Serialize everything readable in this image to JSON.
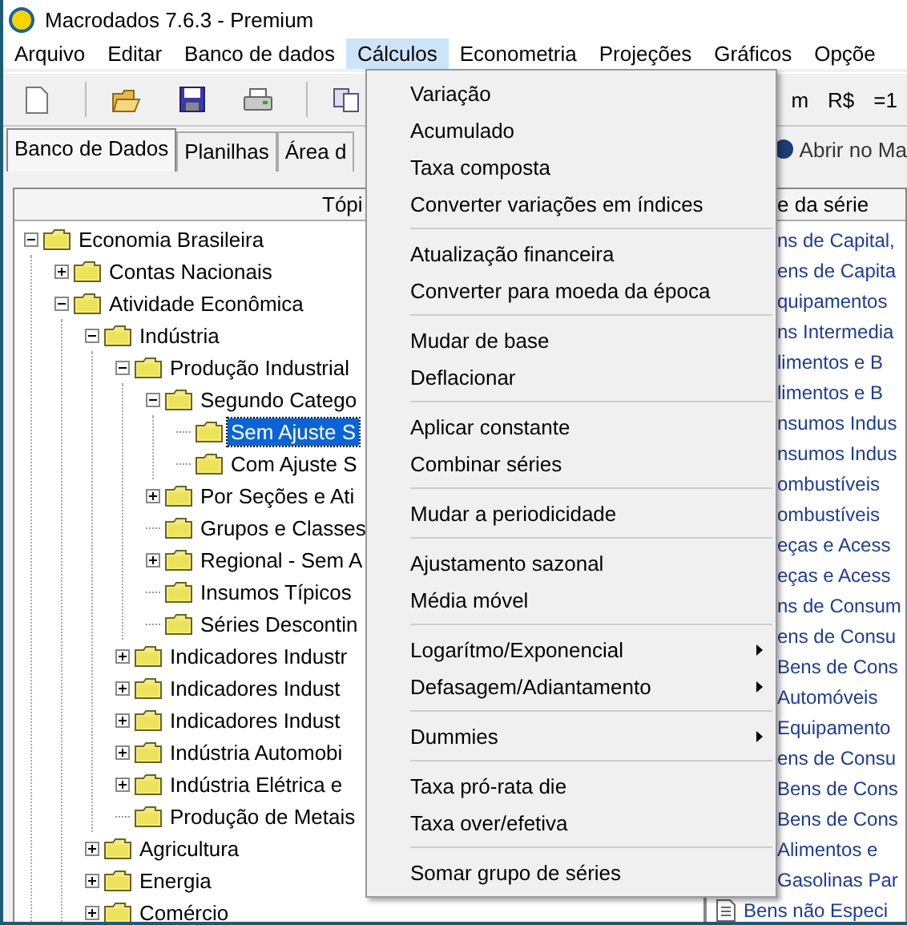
{
  "window": {
    "title": "Macrodados 7.6.3 - Premium"
  },
  "menubar": [
    {
      "label": "Arquivo",
      "selected": false
    },
    {
      "label": "Editar",
      "selected": false
    },
    {
      "label": "Banco de dados",
      "selected": false
    },
    {
      "label": "Cálculos",
      "selected": true
    },
    {
      "label": "Econometria",
      "selected": false
    },
    {
      "label": "Projeções",
      "selected": false
    },
    {
      "label": "Gráficos",
      "selected": false
    },
    {
      "label": "Opçõe",
      "selected": false
    }
  ],
  "toolbar": {
    "texts": [
      "m",
      "R$",
      "=1"
    ]
  },
  "tabs": [
    {
      "label": "Banco de Dados",
      "selected": true
    },
    {
      "label": "Planilhas",
      "selected": false
    },
    {
      "label": "Área d",
      "selected": false
    }
  ],
  "open_button": {
    "label": "Abrir no Ma"
  },
  "tree_header": "Tópi",
  "tree": [
    {
      "label": "Economia Brasileira",
      "expanded": true,
      "selected": false,
      "children": [
        {
          "label": "Contas Nacionais",
          "expanded": false,
          "selected": false
        },
        {
          "label": "Atividade Econômica",
          "expanded": true,
          "selected": false,
          "children": [
            {
              "label": "Indústria",
              "expanded": true,
              "selected": false,
              "children": [
                {
                  "label": "Produção Industrial",
                  "expanded": true,
                  "selected": false,
                  "children": [
                    {
                      "label": "Segundo Catego",
                      "expanded": true,
                      "selected": false,
                      "children": [
                        {
                          "label": "Sem Ajuste S",
                          "selected": true
                        },
                        {
                          "label": "Com Ajuste S",
                          "selected": false
                        }
                      ]
                    },
                    {
                      "label": "Por Seções e Ati",
                      "expanded": false,
                      "selected": false
                    },
                    {
                      "label": "Grupos e Classes",
                      "selected": false
                    },
                    {
                      "label": "Regional - Sem A",
                      "expanded": false,
                      "selected": false
                    },
                    {
                      "label": "Insumos Típicos",
                      "selected": false
                    },
                    {
                      "label": "Séries Descontin",
                      "selected": false
                    }
                  ]
                },
                {
                  "label": "Indicadores Industr",
                  "expanded": false,
                  "selected": false
                },
                {
                  "label": "Indicadores  Indust",
                  "expanded": false,
                  "selected": false
                },
                {
                  "label": "Indicadores  Indust",
                  "expanded": false,
                  "selected": false
                },
                {
                  "label": "Indústria Automobi",
                  "expanded": false,
                  "selected": false
                },
                {
                  "label": "Indústria Elétrica e",
                  "expanded": false,
                  "selected": false
                },
                {
                  "label": "Produção de Metais",
                  "selected": false
                }
              ]
            },
            {
              "label": "Agricultura",
              "expanded": false,
              "selected": false
            },
            {
              "label": "Energia",
              "expanded": false,
              "selected": false
            },
            {
              "label": "Comércio",
              "expanded": false,
              "selected": false
            }
          ]
        }
      ]
    }
  ],
  "series_header": "e da série",
  "series": [
    "ns de Capital,",
    "ens de Capita",
    "quipamentos",
    "ns Intermedia",
    "limentos e B",
    "limentos e B",
    "nsumos Indus",
    "nsumos Indus",
    "ombustíveis",
    "ombustíveis",
    "eças e Acess",
    "eças e Acess",
    "ns de Consum",
    "ens de Consu",
    "Bens de Cons",
    "Automóveis",
    "Equipamento",
    "ens de Consu",
    "Bens de Cons",
    "Bens de Cons",
    "Alimentos e",
    "Gasolinas Par",
    "Bens não Especi"
  ],
  "menu": [
    [
      {
        "label": "Variação",
        "submenu": false
      },
      {
        "label": "Acumulado",
        "submenu": false
      },
      {
        "label": "Taxa composta",
        "submenu": false
      },
      {
        "label": "Converter variações em índices",
        "submenu": false
      }
    ],
    [
      {
        "label": "Atualização financeira",
        "submenu": false
      },
      {
        "label": "Converter para moeda da época",
        "submenu": false
      }
    ],
    [
      {
        "label": "Mudar de base",
        "submenu": false
      },
      {
        "label": "Deflacionar",
        "submenu": false
      }
    ],
    [
      {
        "label": "Aplicar constante",
        "submenu": false
      },
      {
        "label": "Combinar séries",
        "submenu": false
      }
    ],
    [
      {
        "label": "Mudar a periodicidade",
        "submenu": false
      }
    ],
    [
      {
        "label": "Ajustamento sazonal",
        "submenu": false
      },
      {
        "label": "Média móvel",
        "submenu": false
      }
    ],
    [
      {
        "label": "Logarítmo/Exponencial",
        "submenu": true
      },
      {
        "label": "Defasagem/Adiantamento",
        "submenu": true
      }
    ],
    [
      {
        "label": "Dummies",
        "submenu": true
      }
    ],
    [
      {
        "label": "Taxa pró-rata die",
        "submenu": false
      },
      {
        "label": "Taxa over/efetiva",
        "submenu": false
      }
    ],
    [
      {
        "label": "Somar grupo de séries",
        "submenu": false
      }
    ]
  ]
}
